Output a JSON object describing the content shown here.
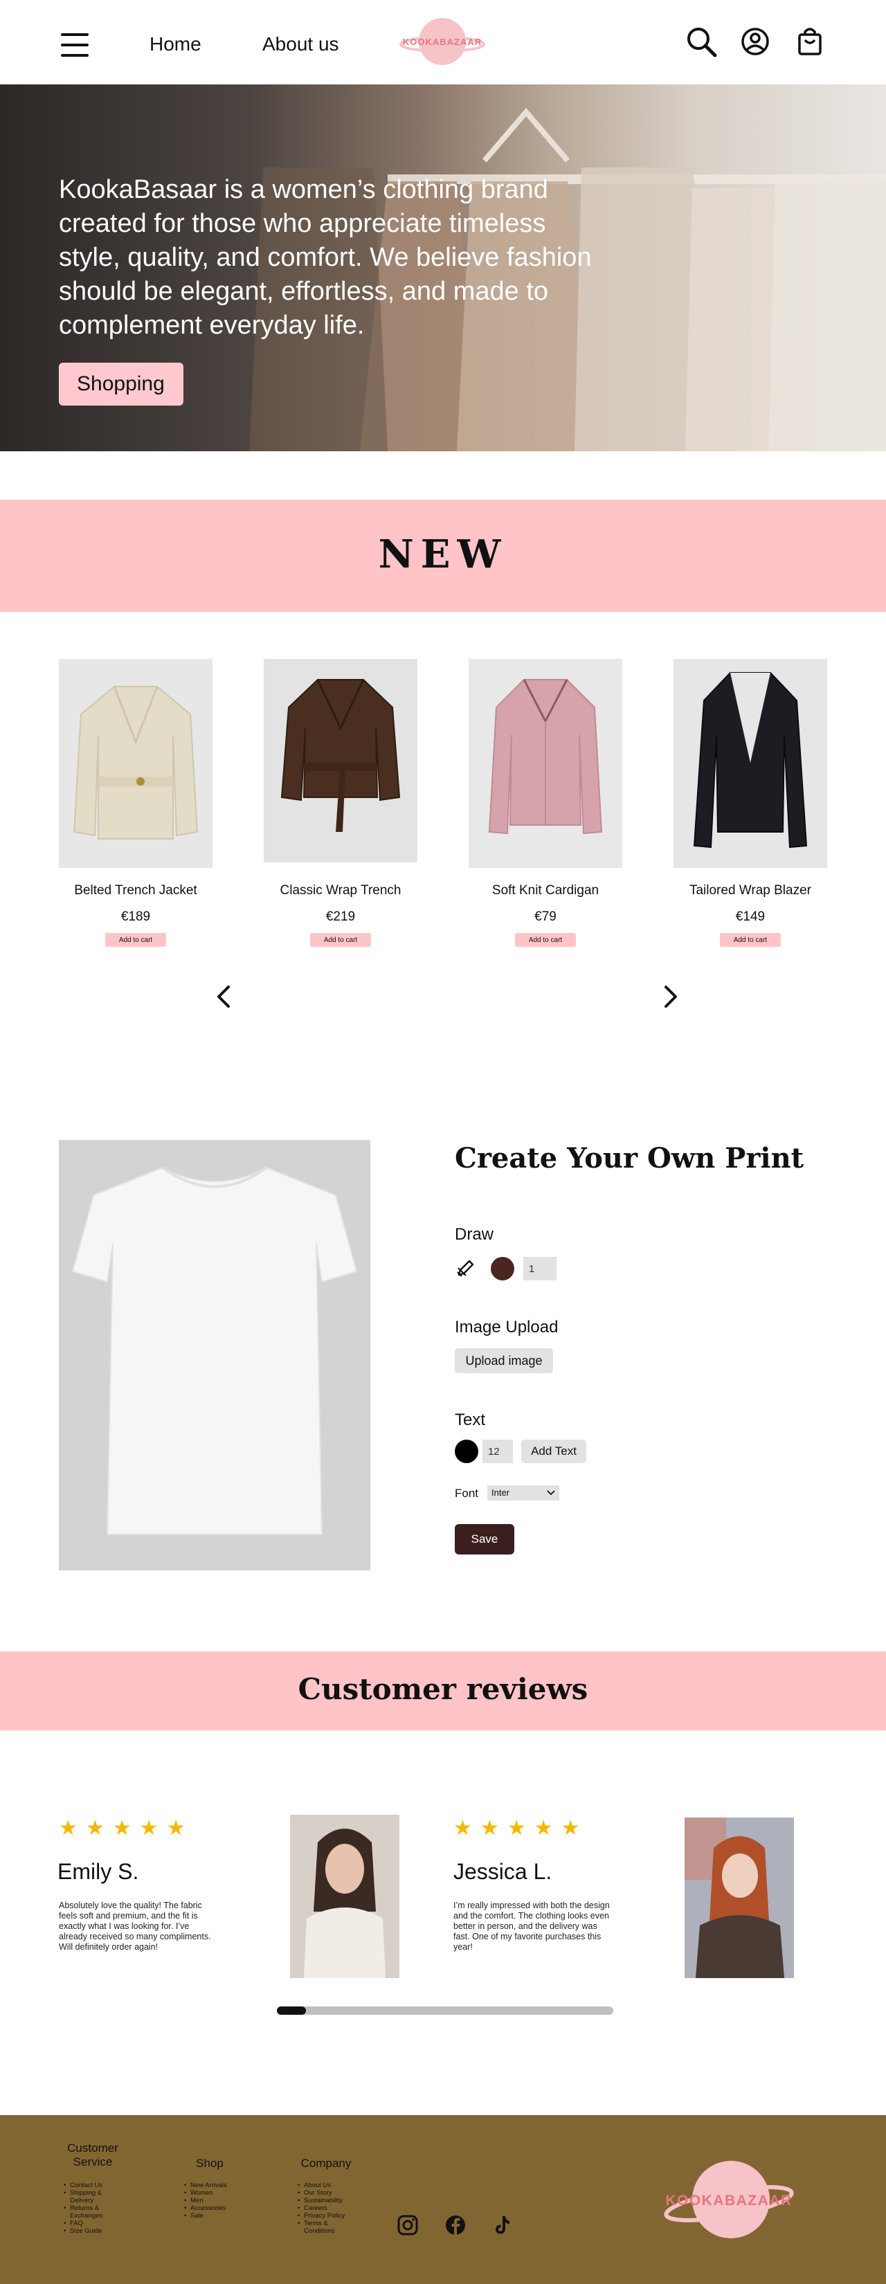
{
  "header": {
    "nav": {
      "home": "Home",
      "about": "About us"
    },
    "logo_text": "KOOKABAZAAR",
    "icons": [
      "hamburger-menu-icon",
      "search-icon",
      "account-icon",
      "shopping-bag-icon"
    ]
  },
  "hero": {
    "text": "KookaBasaar is a women’s clothing brand created for those who appreciate timeless style, quality, and comfort. We believe fashion should be elegant, effortless, and made to complement everyday life.",
    "button": "Shopping"
  },
  "new_section": {
    "title": "NEW",
    "products": [
      {
        "name": "Belted Trench Jacket",
        "price": "€189",
        "cta": "Add to cart",
        "color": "#e3dcc6"
      },
      {
        "name": "Classic Wrap Trench",
        "price": "€219",
        "cta": "Add to cart",
        "color": "#4a2e1f"
      },
      {
        "name": "Soft Knit Cardigan",
        "price": "€79",
        "cta": "Add to cart",
        "color": "#d6a3ad"
      },
      {
        "name": "Tailored Wrap Blazer",
        "price": "€149",
        "cta": "Add to cart",
        "color": "#1c1c22"
      }
    ],
    "icons": [
      "chevron-left-icon",
      "chevron-right-icon"
    ]
  },
  "create_print": {
    "title": "Create Your Own Print",
    "draw": {
      "label": "Draw",
      "brush_color": "#4a2620",
      "size": "1"
    },
    "image_upload": {
      "label": "Image Upload",
      "button": "Upload image"
    },
    "text": {
      "label": "Text",
      "color": "#000000",
      "size": "12",
      "button": "Add Text"
    },
    "font": {
      "label": "Font",
      "selected": "Inter"
    },
    "save": "Save"
  },
  "reviews": {
    "title": "Customer reviews",
    "items": [
      {
        "stars": "★★★★★",
        "name": "Emily S.",
        "text": "Absolutely love the quality! The fabric feels soft and premium, and the fit is exactly what I was looking for. I’ve already received so many compliments. Will definitely order again!"
      },
      {
        "stars": "★★★★★",
        "name": "Jessica L.",
        "text": "I’m really impressed with both the design and the comfort. The clothing looks even better in person, and the delivery was fast. One of my favorite purchases this year!"
      }
    ]
  },
  "footer": {
    "customer_service": {
      "title": "Customer Service",
      "items": [
        "Contact Us",
        "Shipping & Delivery",
        "Returns & Exchanges",
        "FAQ",
        "Size Guide"
      ]
    },
    "shop": {
      "title": "Shop",
      "items": [
        "New Arrivals",
        "Women",
        "Men",
        "Accessories",
        "Sale"
      ]
    },
    "company": {
      "title": "Company",
      "items": [
        "About Us",
        "Our Story",
        "Sustainability",
        "Careers",
        "Privacy Policy",
        "Terms & Conditions"
      ]
    },
    "social_icons": [
      "instagram-icon",
      "facebook-icon",
      "tiktok-icon"
    ],
    "logo_text": "KOOKABAZAAR",
    "colors": {
      "footer_bg": "#826631",
      "accent_pink": "#ffc4c8",
      "save_button": "#3b1f1e"
    }
  }
}
